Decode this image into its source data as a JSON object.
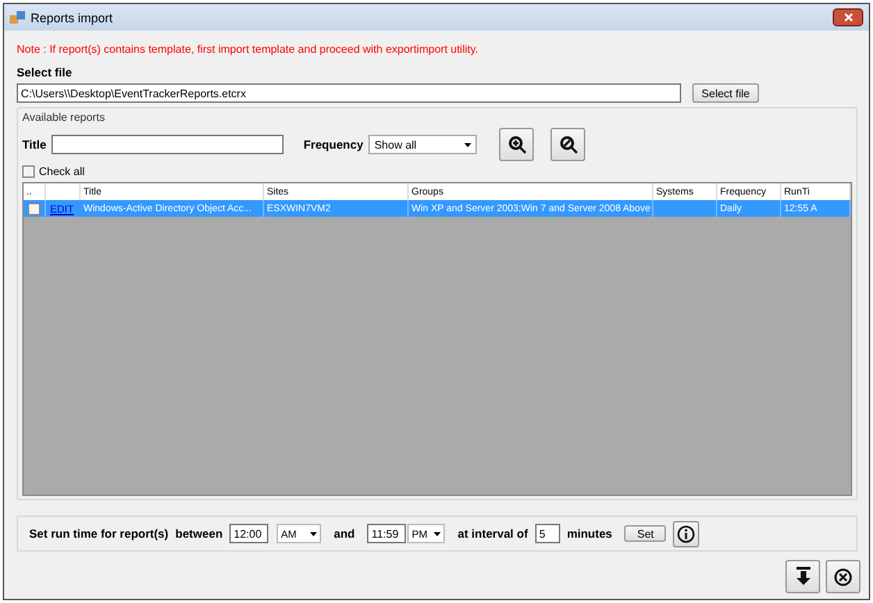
{
  "window": {
    "title": "Reports import"
  },
  "note": "Note : If report(s) contains template, first import template and proceed with exportimport utility.",
  "select_file": {
    "label": "Select file",
    "value": "C:\\Users\\\\Desktop\\EventTrackerReports.etcrx",
    "button": "Select file"
  },
  "available_reports": {
    "legend": "Available reports",
    "title_label": "Title",
    "frequency_label": "Frequency",
    "frequency_value": "Show all",
    "check_all": {
      "label": "Check all",
      "checked": false
    }
  },
  "table": {
    "columns": [
      "..",
      "",
      "Title",
      "Sites",
      "Groups",
      "Systems",
      "Frequency",
      "RunTi"
    ],
    "rows": [
      {
        "checked": false,
        "selected": true,
        "link": "EDIT",
        "title": "Windows-Active Directory Object Acc...",
        "sites": "ESXWIN7VM2",
        "groups": "Win XP and Server 2003;Win 7 and Server 2008 Above",
        "frequency": "Daily",
        "runtime": "12:55 A"
      }
    ]
  },
  "schedule": {
    "label": "Set run time for report(s)",
    "between": "between",
    "start_time": "12:00",
    "start_ampm": "AM",
    "and": "and",
    "end_time": "11:59",
    "end_ampm": "PM",
    "interval_label": "at interval of",
    "interval": "5",
    "minutes": "minutes",
    "set_button": "Set"
  }
}
